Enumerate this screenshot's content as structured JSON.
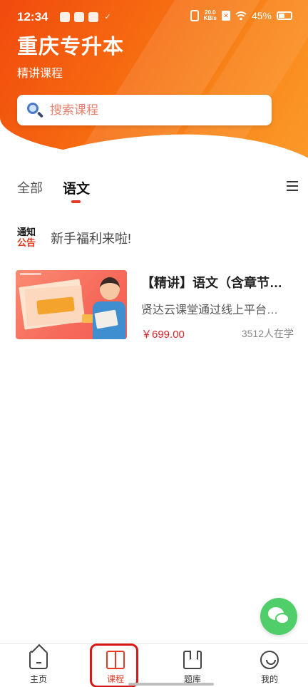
{
  "status_bar": {
    "time": "12:34",
    "net_speed_value": "20.0",
    "net_speed_unit": "KB/s",
    "battery_percent": "45%"
  },
  "header": {
    "title": "重庆专升本",
    "subtitle": "精讲课程"
  },
  "search": {
    "placeholder": "搜索课程"
  },
  "tabs": [
    {
      "label": "全部",
      "active": false
    },
    {
      "label": "语文",
      "active": true
    }
  ],
  "notice": {
    "badge_line1": "通知",
    "badge_line2": "公告",
    "text": "新手福利来啦!"
  },
  "courses": [
    {
      "title": "【精讲】语文（含章节…",
      "description": "贤达云课堂通过线上平台…",
      "price": "￥699.00",
      "students": "3512人在学"
    }
  ],
  "bottom_nav": [
    {
      "label": "主页",
      "icon": "home-icon",
      "active": false
    },
    {
      "label": "课程",
      "icon": "book-icon",
      "active": true
    },
    {
      "label": "题库",
      "icon": "question-bank-icon",
      "active": false
    },
    {
      "label": "我的",
      "icon": "profile-icon",
      "active": false
    }
  ],
  "colors": {
    "accent": "#e43b23",
    "header_gradient_start": "#f14a0e",
    "header_gradient_end": "#fb9a2a",
    "price": "#d8262a",
    "wechat": "#4fce6a"
  }
}
